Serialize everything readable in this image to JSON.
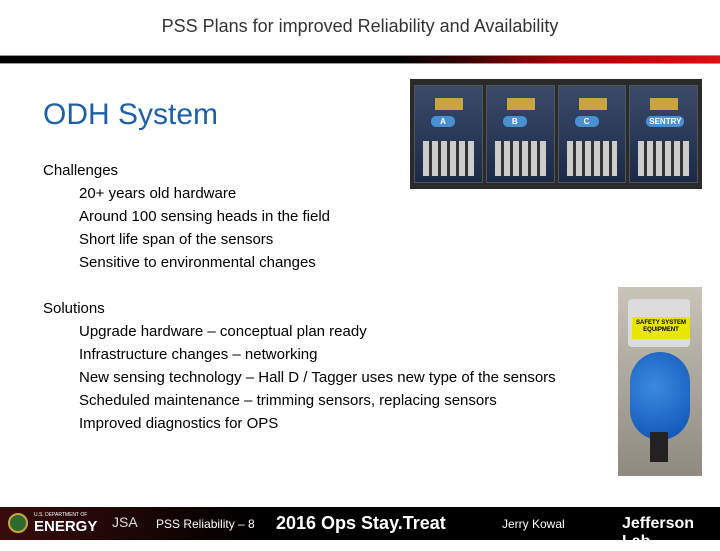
{
  "header": {
    "title": "PSS Plans for improved Reliability and Availability"
  },
  "slide": {
    "heading": "ODH System",
    "challenges": {
      "label": "Challenges",
      "items": [
        "20+ years old hardware",
        "Around 100 sensing heads in the field",
        "Short life span of the sensors",
        "Sensitive to environmental changes"
      ]
    },
    "solutions": {
      "label": "Solutions",
      "items": [
        "Upgrade hardware – conceptual plan ready",
        "Infrastructure changes – networking",
        "New sensing technology – Hall D / Tagger uses new type of the sensors",
        "Scheduled maintenance – trimming sensors, replacing sensors",
        "Improved diagnostics for OPS"
      ]
    },
    "photo_panel_labels": [
      "A",
      "B",
      "C",
      "SENTRY"
    ],
    "photo_sensor_label": "SAFETY SYSTEM EQUIPMENT"
  },
  "footer": {
    "doe_small": "U.S. DEPARTMENT OF",
    "doe": "ENERGY",
    "jsa": "JSA",
    "slide_ref": "PSS Reliability – 8",
    "event": "2016 Ops Stay.Treat",
    "author": "Jerry Kowal",
    "lab": "Jefferson Lab"
  }
}
